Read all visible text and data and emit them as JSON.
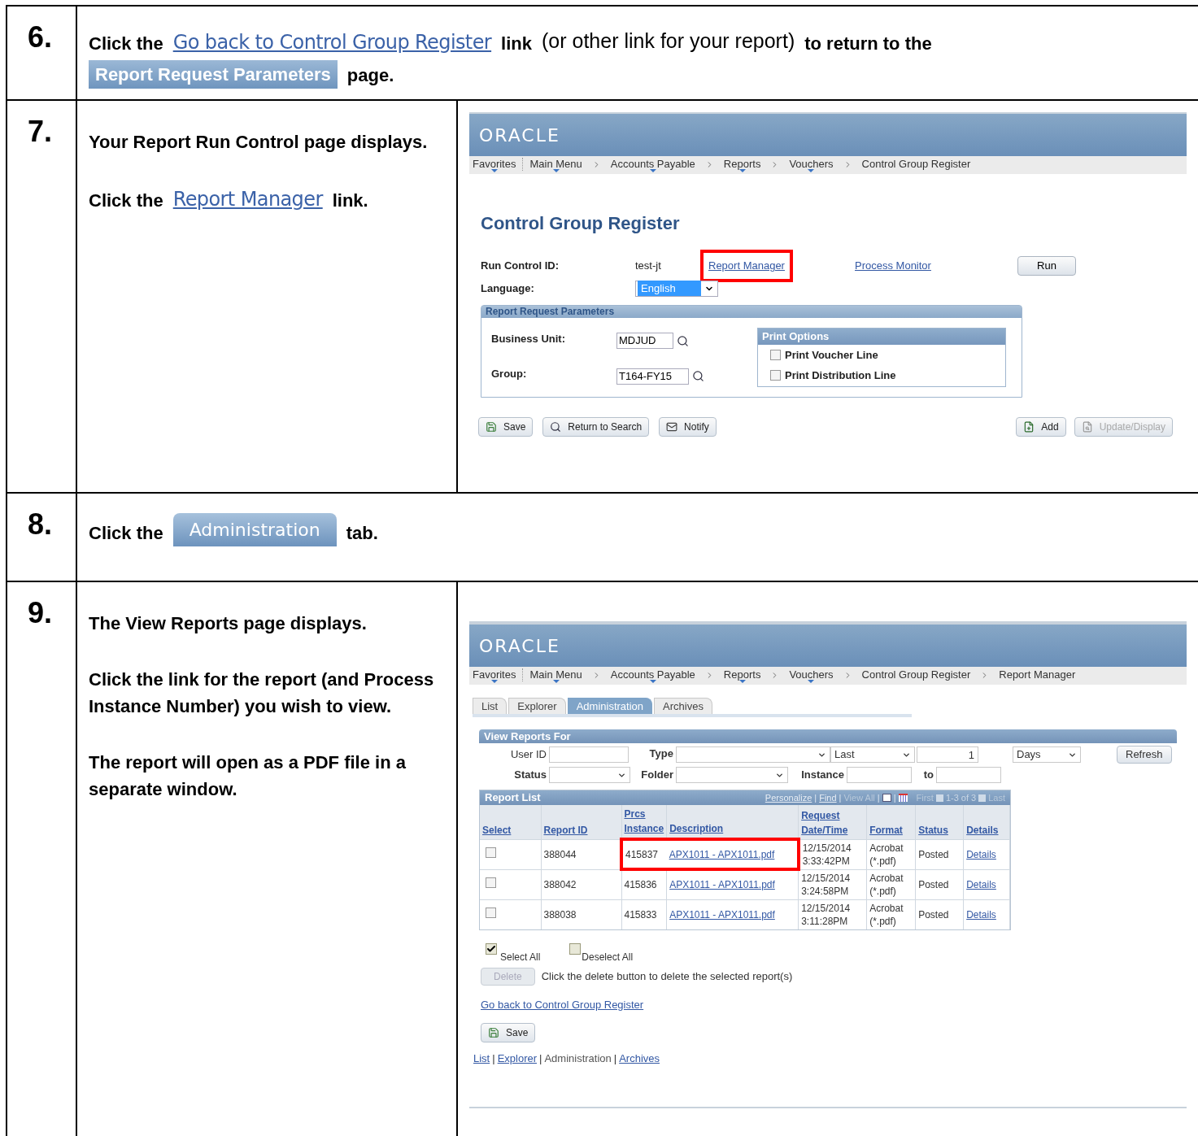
{
  "steps": [
    {
      "number": "6.",
      "kind": "full",
      "lines": [
        [
          {
            "kind": "bold",
            "text": "Click the"
          },
          {
            "kind": "link-image",
            "text": "Go back to Control Group Register"
          },
          {
            "kind": "bold",
            "text": "link"
          },
          {
            "kind": "plain",
            "text": "(or other link for your report)"
          },
          {
            "kind": "bold",
            "text": "to return to the"
          }
        ],
        [
          {
            "kind": "header-image",
            "text": "Report Request Parameters"
          },
          {
            "kind": "bold",
            "text": "page."
          }
        ]
      ]
    },
    {
      "number": "7.",
      "kind": "split",
      "lines": [
        [
          {
            "kind": "bold",
            "text": "Your Report Run Control page displays."
          }
        ],
        [
          {
            "kind": "bold",
            "text": "Click the"
          },
          {
            "kind": "link-image",
            "text": "Report Manager"
          },
          {
            "kind": "bold",
            "text": "link."
          }
        ]
      ],
      "screen": {
        "kind": "run-control",
        "logo": "ORACLE",
        "breadcrumbs": [
          {
            "label": "Favorites",
            "menu": true
          },
          {
            "label": "Main Menu",
            "menu": true
          },
          {
            "label": "Accounts Payable",
            "menu": true
          },
          {
            "label": "Reports",
            "menu": true
          },
          {
            "label": "Vouchers",
            "menu": true
          },
          {
            "label": "Control Group Register",
            "menu": false
          }
        ],
        "title": "Control Group Register",
        "run_control_label": "Run Control ID:",
        "run_control_value": "test-jt",
        "links": [
          {
            "label": "Report Manager",
            "highlighted": true
          },
          {
            "label": "Process Monitor",
            "highlighted": false
          }
        ],
        "run_button": "Run",
        "language_label": "Language:",
        "language_value": "English",
        "params": {
          "title": "Report Request Parameters",
          "fields": [
            {
              "label": "Business Unit:",
              "value": "MDJUD"
            },
            {
              "label": "Group:",
              "value": "T164-FY15"
            }
          ],
          "print_options": {
            "title": "Print Options",
            "items": [
              {
                "label": "Print Voucher Line",
                "checked": false
              },
              {
                "label": "Print Distribution Line",
                "checked": false
              }
            ]
          }
        },
        "buttons_left": [
          {
            "kind": "save",
            "label": "Save"
          },
          {
            "kind": "search",
            "label": "Return to Search"
          },
          {
            "kind": "notify",
            "label": "Notify"
          }
        ],
        "buttons_right": [
          {
            "kind": "add",
            "label": "Add",
            "disabled": false
          },
          {
            "kind": "update",
            "label": "Update/Display",
            "disabled": true
          }
        ]
      }
    },
    {
      "number": "8.",
      "kind": "full",
      "lines": [
        [
          {
            "kind": "bold",
            "text": "Click the"
          },
          {
            "kind": "tab-image",
            "text": "Administration"
          },
          {
            "kind": "bold",
            "text": "tab."
          }
        ]
      ]
    },
    {
      "number": "9.",
      "kind": "split",
      "lines": [
        [
          {
            "kind": "bold",
            "text": "The View Reports page displays."
          }
        ],
        [
          {
            "kind": "bold",
            "text": "Click the link for the report (and Process Instance Number) you wish to view."
          }
        ],
        [
          {
            "kind": "bold",
            "text": "The report will open as a PDF file in a separate window."
          }
        ]
      ],
      "screen": {
        "kind": "report-manager",
        "logo": "ORACLE",
        "breadcrumbs": [
          {
            "label": "Favorites",
            "menu": true
          },
          {
            "label": "Main Menu",
            "menu": true
          },
          {
            "label": "Accounts Payable",
            "menu": true
          },
          {
            "label": "Reports",
            "menu": true
          },
          {
            "label": "Vouchers",
            "menu": true
          },
          {
            "label": "Control Group Register",
            "menu": false
          },
          {
            "label": "Report Manager",
            "menu": false
          }
        ],
        "tabs": [
          {
            "label": "List",
            "selected": false
          },
          {
            "label": "Explorer",
            "selected": false
          },
          {
            "label": "Administration",
            "selected": true
          },
          {
            "label": "Archives",
            "selected": false
          }
        ],
        "filters": {
          "title": "View Reports For",
          "user_id": "User ID",
          "type": "Type",
          "period": "Last",
          "count": "1",
          "unit": "Days",
          "refresh": "Refresh",
          "status": "Status",
          "folder": "Folder",
          "instance": "Instance",
          "to": "to"
        },
        "report_list": {
          "title": "Report List",
          "nav_links": [
            "Personalize",
            "Find"
          ],
          "view_all": "View All",
          "separator": "|",
          "first": "First",
          "range": "1-3 of 3",
          "last": "Last",
          "columns": [
            "Select",
            "Report ID",
            "Prcs Instance",
            "Description",
            "Request Date/Time",
            "Format",
            "Status",
            "Details"
          ],
          "rows": [
            {
              "checked": false,
              "report_id": "388044",
              "instance": "415837",
              "description": "APX1011 - APX1011.pdf",
              "datetime": "12/15/2014 3:33:42PM",
              "format": "Acrobat (*.pdf)",
              "status": "Posted",
              "details": "Details",
              "highlighted": true
            },
            {
              "checked": false,
              "report_id": "388042",
              "instance": "415836",
              "description": "APX1011 - APX1011.pdf",
              "datetime": "12/15/2014 3:24:58PM",
              "format": "Acrobat (*.pdf)",
              "status": "Posted",
              "details": "Details",
              "highlighted": false
            },
            {
              "checked": false,
              "report_id": "388038",
              "instance": "415833",
              "description": "APX1011 - APX1011.pdf",
              "datetime": "12/15/2014 3:11:28PM",
              "format": "Acrobat (*.pdf)",
              "status": "Posted",
              "details": "Details",
              "highlighted": false
            }
          ]
        },
        "select_all": {
          "label": "Select All",
          "checked": true
        },
        "deselect_all": {
          "label": "Deselect All",
          "checked": false
        },
        "delete_button": {
          "label": "Delete",
          "disabled": true
        },
        "delete_hint": "Click the delete button to delete the selected report(s)",
        "back_link": "Go back to Control Group Register",
        "save_button": "Save",
        "footer_links": [
          {
            "label": "List",
            "link": true
          },
          {
            "label": "Explorer",
            "link": true
          },
          {
            "label": "Administration",
            "link": false
          },
          {
            "label": "Archives",
            "link": true
          }
        ],
        "footer_separator": "|"
      }
    }
  ]
}
